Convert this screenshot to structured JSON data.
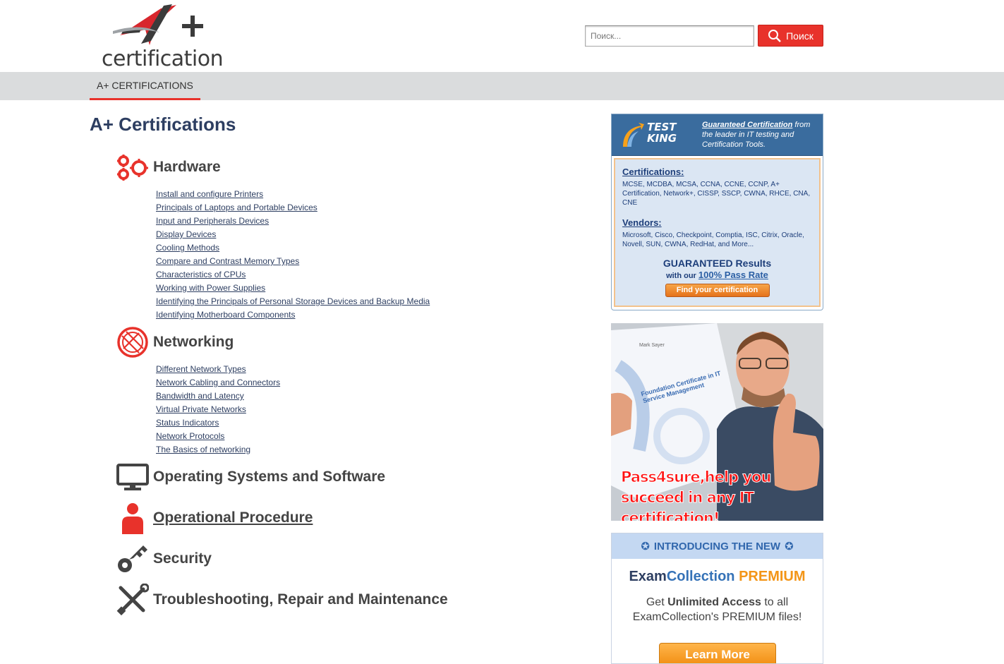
{
  "header": {
    "logo_text": "certification",
    "search_placeholder": "Поиск...",
    "search_button_label": "Поиск"
  },
  "nav": {
    "tabs": [
      {
        "label": "A+ CERTIFICATIONS",
        "active": true
      }
    ]
  },
  "main": {
    "title": "A+ Certifications",
    "sections": [
      {
        "title": "Hardware",
        "icon": "gears-icon",
        "links": [
          "Install and configure Printers",
          "Principals of Laptops and Portable Devices",
          "Input and Peripherals Devices",
          "Display Devices",
          "Cooling Methods",
          "Compare and Contrast Memory Types",
          "Characteristics of CPUs",
          "Working with Power Supplies",
          "Identifying the Principals of Personal Storage Devices and Backup Media",
          "Identifying Motherboard Components"
        ]
      },
      {
        "title": "Networking",
        "icon": "globe-icon",
        "links": [
          "Different Network Types",
          "Network Cabling and Connectors",
          "Bandwidth and Latency",
          "Virtual Private Networks",
          "Status Indicators",
          "Network Protocols",
          "The Basics of networking"
        ]
      },
      {
        "title": "Operating Systems and Software",
        "icon": "monitor-icon"
      },
      {
        "title": "Operational Procedure",
        "icon": "person-icon"
      },
      {
        "title": "Security",
        "icon": "key-icon"
      },
      {
        "title": "Troubleshooting, Repair and Maintenance",
        "icon": "tools-icon"
      }
    ]
  },
  "sidebar": {
    "ad_testking": {
      "logo_line1": "TEST",
      "logo_line2": "KING",
      "tag_link": "Guaranteed Certification",
      "tag_rest": "from the leader in IT testing and Certification Tools.",
      "cert_heading": "Certifications:",
      "cert_list": "MCSE, MCDBA, MCSA, CCNA, CCNE, CCNP, A+ Certification, Network+, CISSP, SSCP, CWNA, RHCE, CNA, CNE",
      "vendor_heading": "Vendors:",
      "vendor_list": "Microsoft, Cisco, Checkpoint, Comptia, ISC, Citrix, Oracle, Novell, SUN, CWNA, RedHat, and More...",
      "guaranteed": "GUARANTEED Results",
      "rate_prefix": "with our",
      "rate_link": "100% Pass Rate",
      "button": "Find your certification"
    },
    "ad_pass4sure": {
      "cert_name": "Mark Sayer",
      "cert_title": "Foundation Certificate in IT Service Management",
      "line1": "Pass4sure,help you",
      "line2": "succeed in any IT certification!"
    },
    "ad_examcollection": {
      "band": "INTRODUCING THE NEW",
      "brand1": "Exam",
      "brand2": "Collection",
      "brand3": "PREMIUM",
      "text1": "Get",
      "text_bold": "Unlimited Access",
      "text2": "to all",
      "text3": "ExamCollection's PREMIUM files!",
      "button": "Learn More"
    }
  }
}
